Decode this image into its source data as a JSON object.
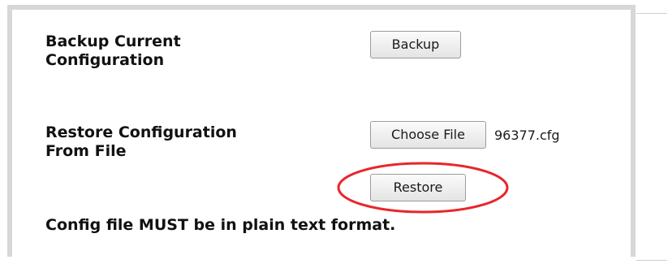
{
  "backup": {
    "label_line1": "Backup Current",
    "label_line2": "Configuration",
    "button_label": "Backup"
  },
  "restore": {
    "label_line1": "Restore Configuration",
    "label_line2": "From File",
    "choose_file_label": "Choose File",
    "selected_file": "96377.cfg",
    "button_label": "Restore"
  },
  "note": "Config file MUST be in plain text format.",
  "colors": {
    "annotation_circle": "#e8262b",
    "panel_border": "#d7d7d7"
  }
}
